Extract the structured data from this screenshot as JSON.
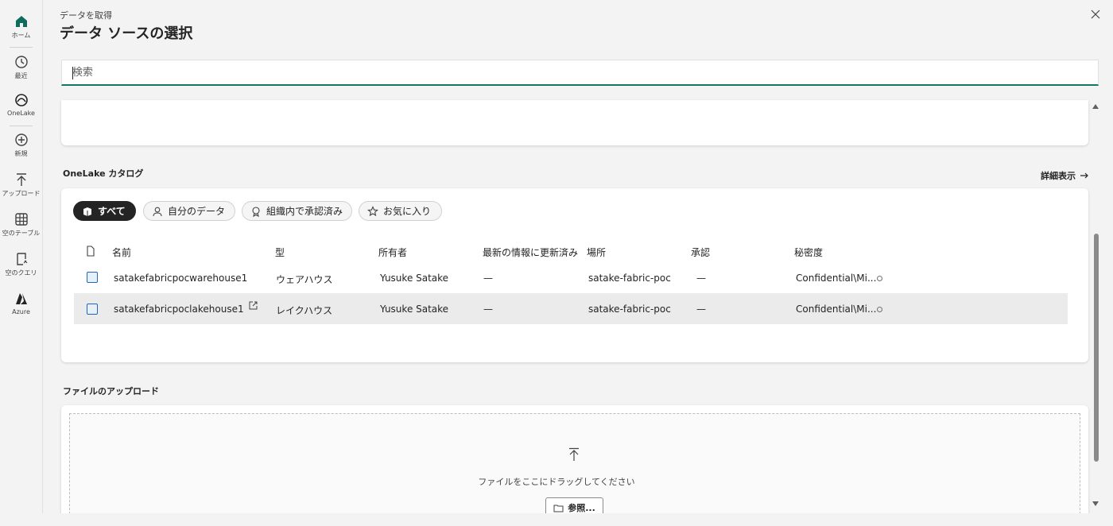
{
  "rail": {
    "items": [
      {
        "label": "ホーム",
        "icon": "home-icon"
      },
      {
        "label": "最近",
        "icon": "clock-icon"
      },
      {
        "label": "OneLake",
        "icon": "onelake-icon"
      },
      {
        "label": "新規",
        "icon": "plus-circle-icon"
      },
      {
        "label": "アップロード",
        "icon": "upload-icon"
      },
      {
        "label": "空のテーブル",
        "icon": "table-icon"
      },
      {
        "label": "空のクエリ",
        "icon": "query-icon"
      },
      {
        "label": "Azure",
        "icon": "azure-icon"
      }
    ]
  },
  "header": {
    "subtitle": "データを取得",
    "title": "データ ソースの選択"
  },
  "search": {
    "placeholder": "検索",
    "value": ""
  },
  "catalog": {
    "title": "OneLake カタログ",
    "details_link": "詳細表示",
    "filters": [
      {
        "label": "すべて",
        "active": true,
        "icon": "all-items-icon"
      },
      {
        "label": "自分のデータ",
        "active": false,
        "icon": "person-icon"
      },
      {
        "label": "組織内で承認済み",
        "active": false,
        "icon": "ribbon-icon"
      },
      {
        "label": "お気に入り",
        "active": false,
        "icon": "star-icon"
      }
    ],
    "columns": [
      "名前",
      "型",
      "所有者",
      "最新の情報に更新済み",
      "場所",
      "承認",
      "秘密度"
    ],
    "rows": [
      {
        "name": "satakefabricpocwarehouse1",
        "type": "ウェアハウス",
        "owner": "Yusuke Satake",
        "refreshed": "—",
        "location": "satake-fabric-poc",
        "endorsement": "—",
        "sensitivity": "Confidential\\Mi...",
        "selected": false
      },
      {
        "name": "satakefabricpoclakehouse1",
        "type": "レイクハウス",
        "owner": "Yusuke Satake",
        "refreshed": "—",
        "location": "satake-fabric-poc",
        "endorsement": "—",
        "sensitivity": "Confidential\\Mi...",
        "selected": true
      }
    ]
  },
  "upload": {
    "title": "ファイルのアップロード",
    "drop_text": "ファイルをここにドラッグしてください",
    "browse_label": "参照..."
  },
  "colors": {
    "accent": "#117865",
    "active_pill": "#242424",
    "selected_row": "#ebebeb"
  }
}
